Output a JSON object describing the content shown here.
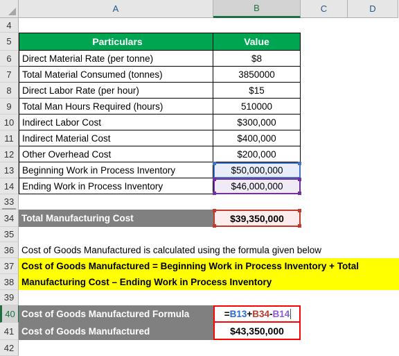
{
  "spreadsheet": {
    "columns": [
      {
        "id": "A",
        "label": "A",
        "selected": false
      },
      {
        "id": "B",
        "label": "B",
        "selected": true
      },
      {
        "id": "C",
        "label": "C",
        "selected": false
      },
      {
        "id": "D",
        "label": "D",
        "selected": false
      }
    ],
    "row_numbers": {
      "r4": "4",
      "r5": "5",
      "r6": "6",
      "r7": "7",
      "r8": "8",
      "r9": "9",
      "r10": "10",
      "r11": "11",
      "r12": "12",
      "r13": "13",
      "r14": "14",
      "r33": "33",
      "r34": "34",
      "r35": "35",
      "r36": "36",
      "r37": "37",
      "r38": "38",
      "r39": "39",
      "r40": "40",
      "r41": "41",
      "r42": "42"
    },
    "header": {
      "particulars": "Particulars",
      "value": "Value"
    },
    "rows": [
      {
        "label": "Direct Material Rate (per tonne)",
        "value": "$8"
      },
      {
        "label": "Total Material Consumed (tonnes)",
        "value": "3850000"
      },
      {
        "label": "Direct Labor Rate (per hour)",
        "value": "$15"
      },
      {
        "label": "Total Man Hours Required (hours)",
        "value": "510000"
      },
      {
        "label": "Indirect Labor Cost",
        "value": "$300,000"
      },
      {
        "label": "Indirect Material Cost",
        "value": "$400,000"
      },
      {
        "label": "Other Overhead Cost",
        "value": "$200,000"
      },
      {
        "label": "Beginning Work in Process Inventory",
        "value": "$50,000,000"
      },
      {
        "label": "Ending Work in Process Inventory",
        "value": "$46,000,000"
      }
    ],
    "total_manufacturing": {
      "label": "Total Manufacturing Cost",
      "value": "$39,350,000"
    },
    "note": "Cost of Goods Manufactured is calculated using the formula given below",
    "formula_text_line1": "Cost of Goods Manufactured = Beginning Work in Process Inventory + Total",
    "formula_text_line2": "Manufacturing Cost – Ending Work in Process Inventory",
    "formula_row": {
      "label": "Cost of Goods Manufactured Formula",
      "equals": "=",
      "ref1": "B13",
      "op1": "+",
      "ref2": "B34",
      "op2": "-",
      "ref3": "B14"
    },
    "result_row": {
      "label": "Cost of Goods Manufactured",
      "value": "$43,350,000"
    },
    "colors": {
      "header_green": "#00a551",
      "label_gray": "#808080",
      "highlight_yellow": "#ffff00",
      "ref_blue": "#2a68d8",
      "ref_red": "#c0392b",
      "ref_purple": "#8d5bd6",
      "edit_border_red": "#ff0000",
      "selection_green": "#1d6f42"
    }
  }
}
